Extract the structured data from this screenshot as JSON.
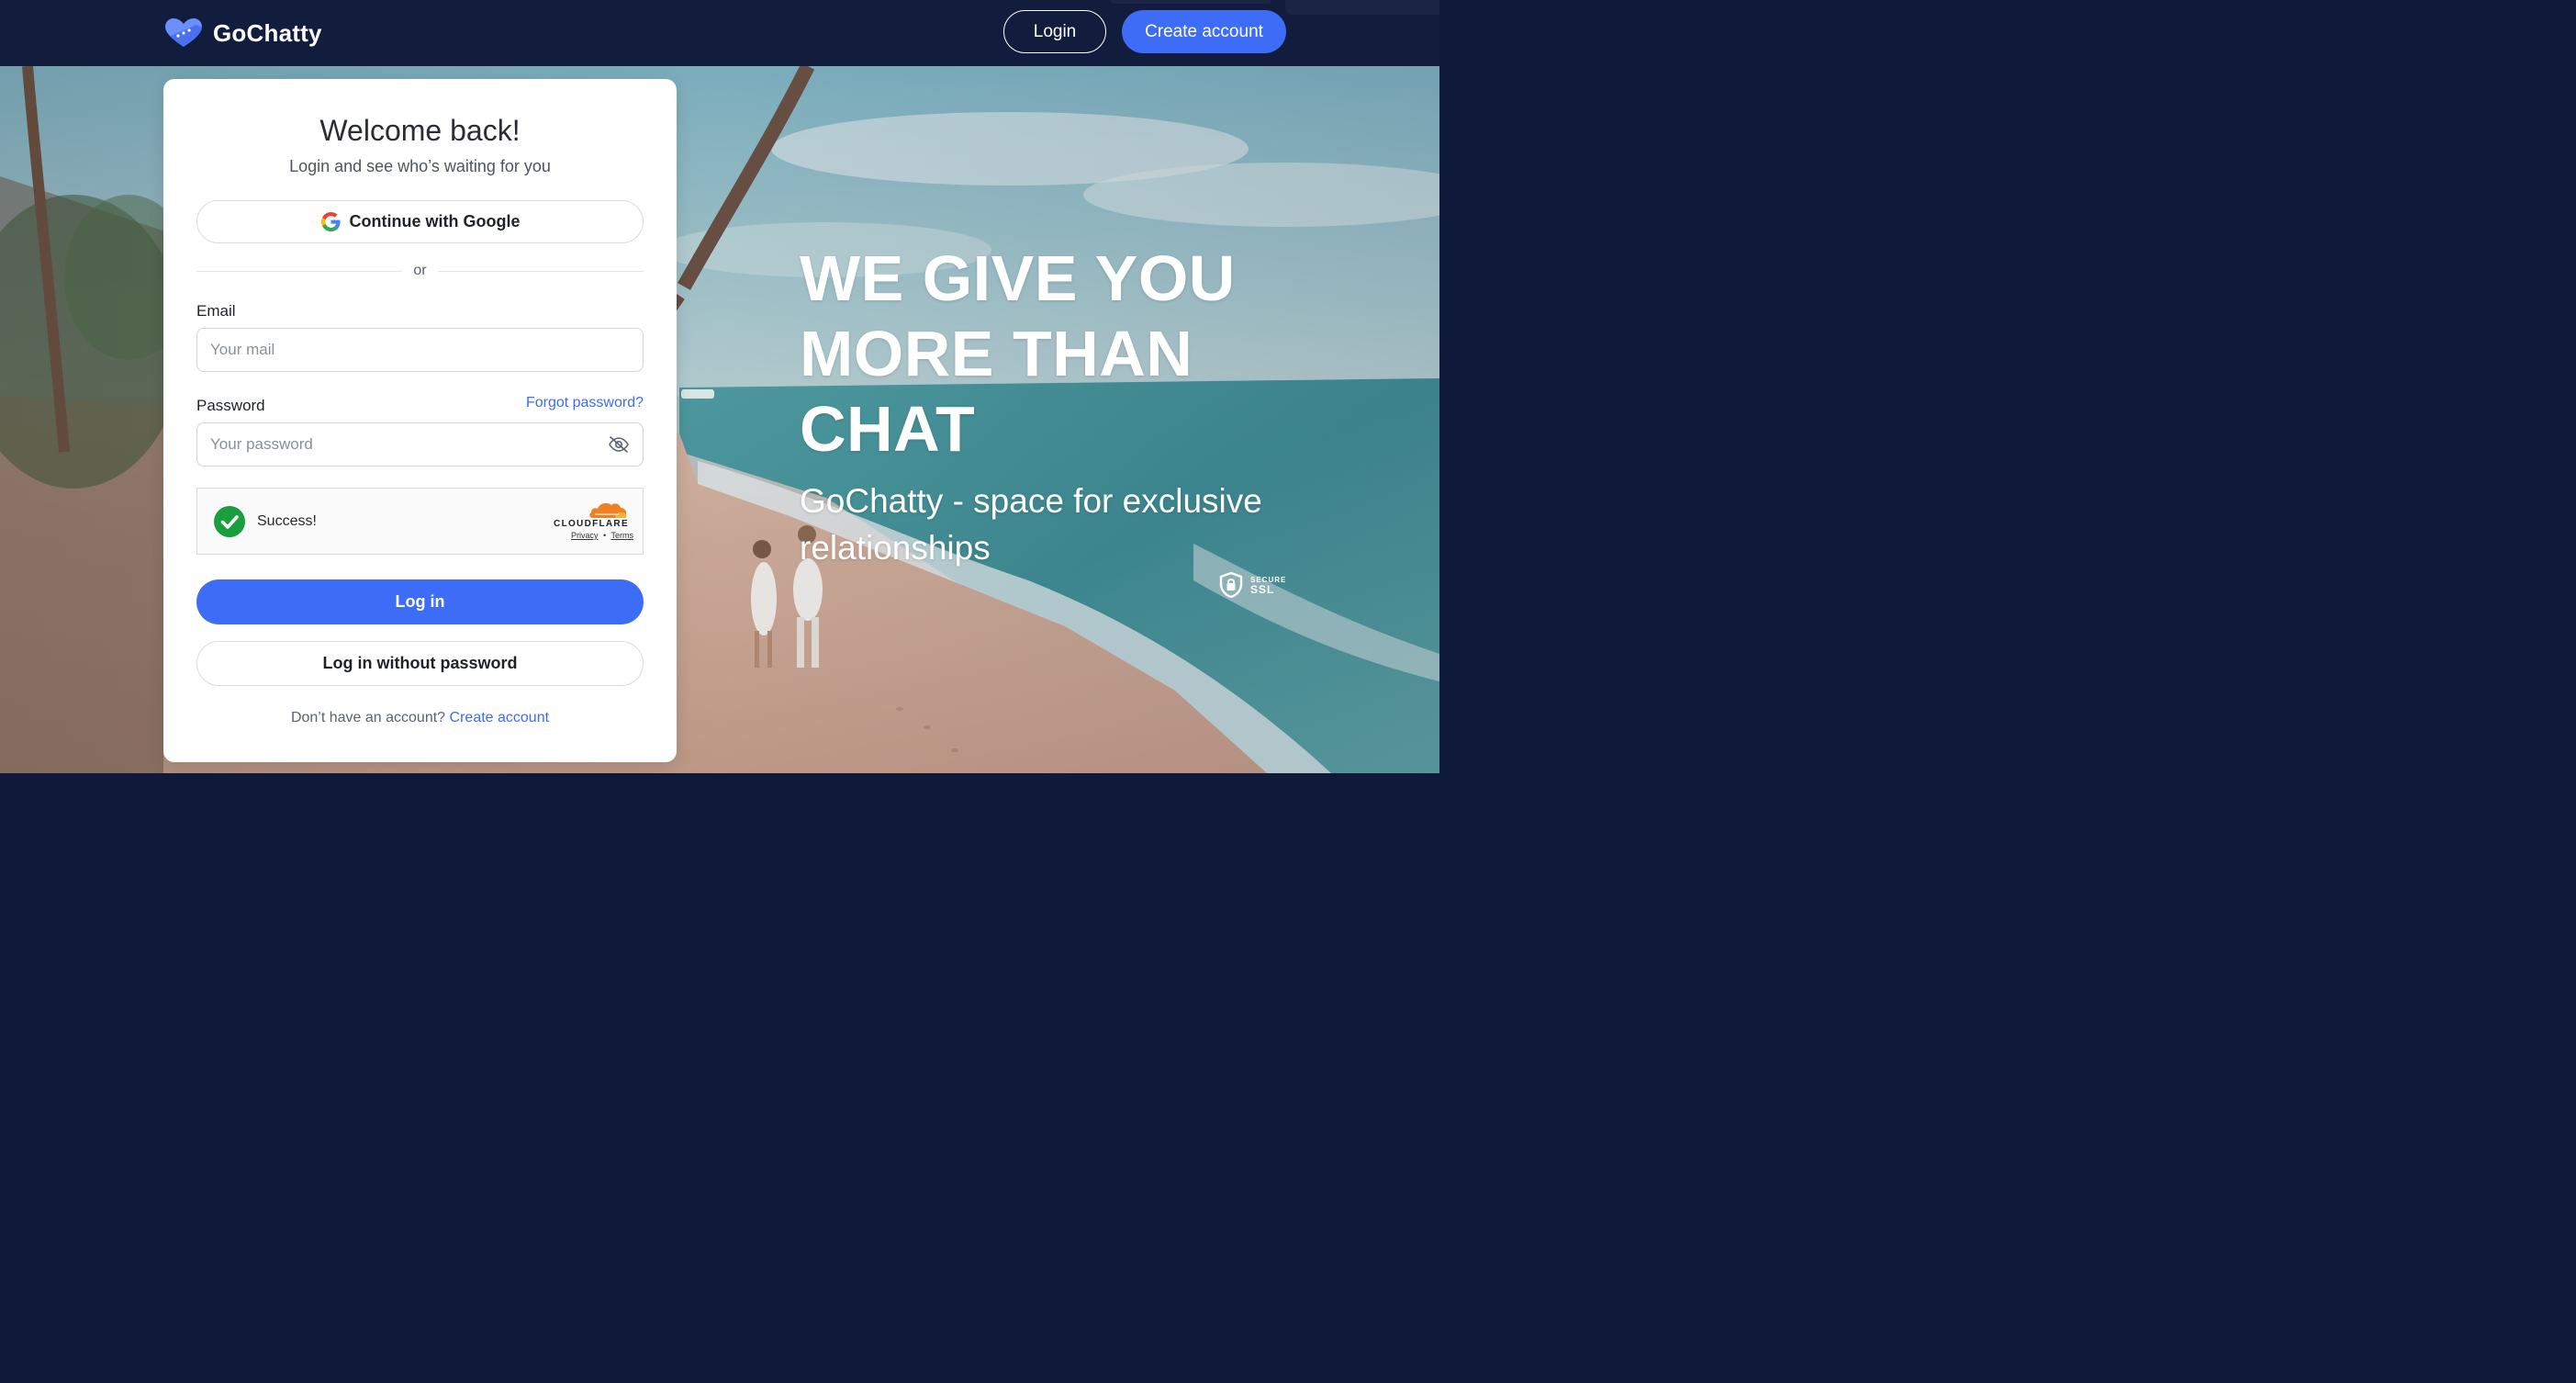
{
  "header": {
    "brand_name": "GoChatty",
    "login_label": "Login",
    "create_account_label": "Create account"
  },
  "card": {
    "title": "Welcome back!",
    "subtitle": "Login and see who’s waiting for you",
    "google_button_label": "Continue with Google",
    "divider_text": "or",
    "email": {
      "label": "Email",
      "placeholder": "Your mail",
      "value": ""
    },
    "password": {
      "label": "Password",
      "placeholder": "Your password",
      "value": "",
      "forgot_link": "Forgot password?",
      "toggle_icon": "eye-off-icon"
    },
    "captcha": {
      "status_text": "Success!",
      "provider": "CLOUDFLARE",
      "privacy_link": "Privacy",
      "separator": "•",
      "terms_link": "Terms"
    },
    "login_button_label": "Log in",
    "passwordless_button_label": "Log in without password",
    "signup_prompt": "Don’t have an account?",
    "signup_link": "Create account"
  },
  "hero": {
    "title_lines": [
      "WE GIVE YOU",
      "MORE THAN",
      "CHAT"
    ],
    "subtitle_lines": [
      "GoChatty - space for exclusive",
      "relationships"
    ],
    "ssl_badge": {
      "small_text": "SECURE",
      "big_text": "SSL"
    }
  },
  "colors": {
    "header_bg": "#121c3d",
    "accent": "#3d6cf7",
    "card_bg": "#ffffff",
    "captcha_success": "#1a9e3f",
    "cloudflare_orange": "#f38020"
  }
}
